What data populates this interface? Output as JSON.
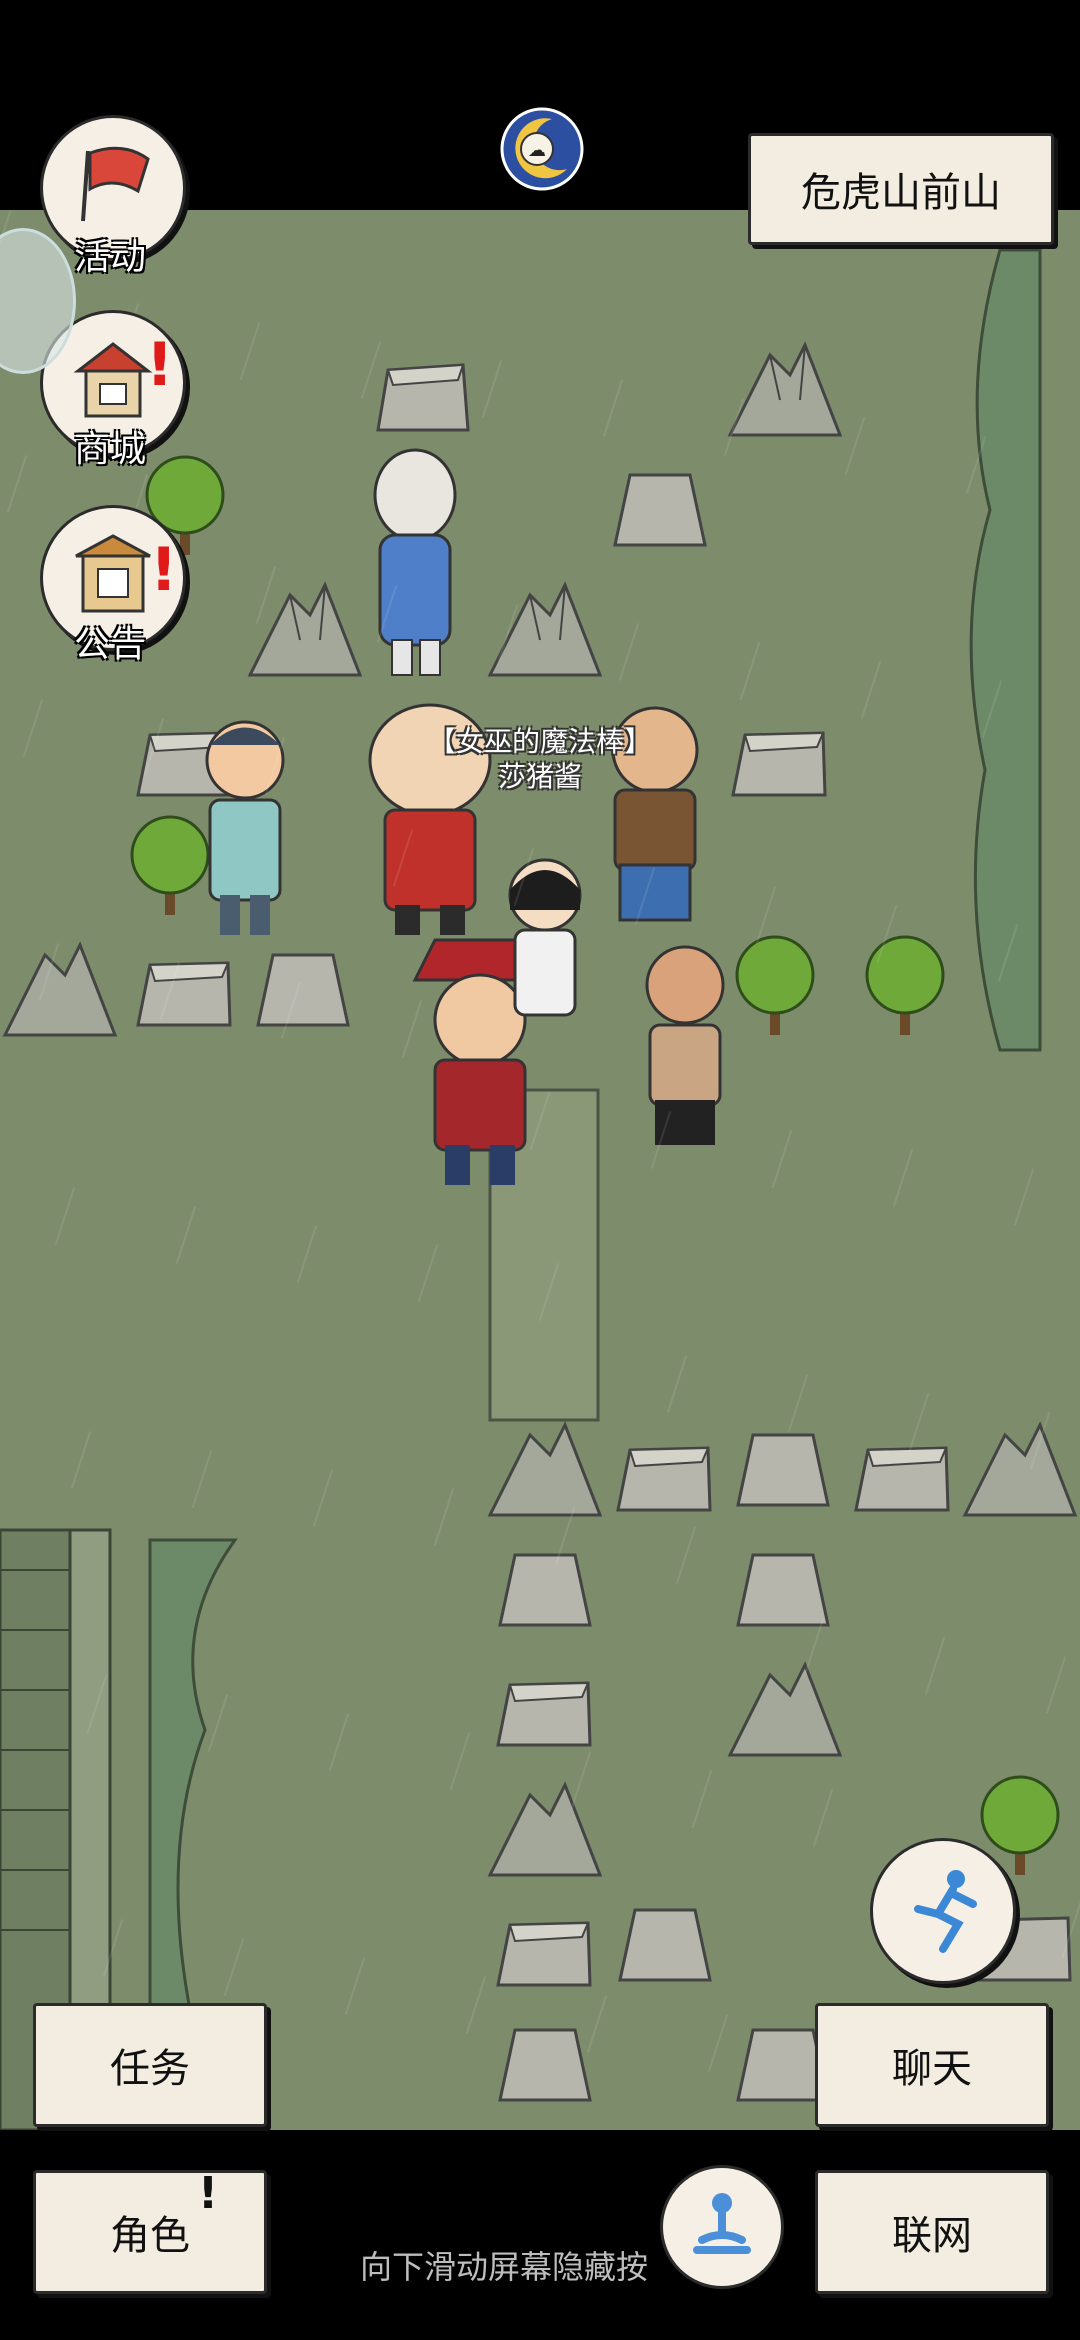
{
  "location_title": "危虎山前山",
  "left_menu": [
    {
      "label": "活动",
      "icon": "flag-icon",
      "badge": false
    },
    {
      "label": "商城",
      "icon": "shop-icon",
      "badge": true
    },
    {
      "label": "公告",
      "icon": "notice-board-icon",
      "badge": true
    }
  ],
  "characters": {
    "player_title": "【女巫的魔法棒】",
    "player_name": "莎猪酱"
  },
  "bottom_buttons": {
    "task": "任务",
    "chat": "聊天",
    "role": "角色",
    "network": "联网"
  },
  "role_badge": "!",
  "badge_mark": "!",
  "hint_text": "向下滑动屏幕隐藏按",
  "colors": {
    "map_ground": "#7d8c6b",
    "button_bg": "#f3ece0",
    "badge": "#e01919"
  }
}
